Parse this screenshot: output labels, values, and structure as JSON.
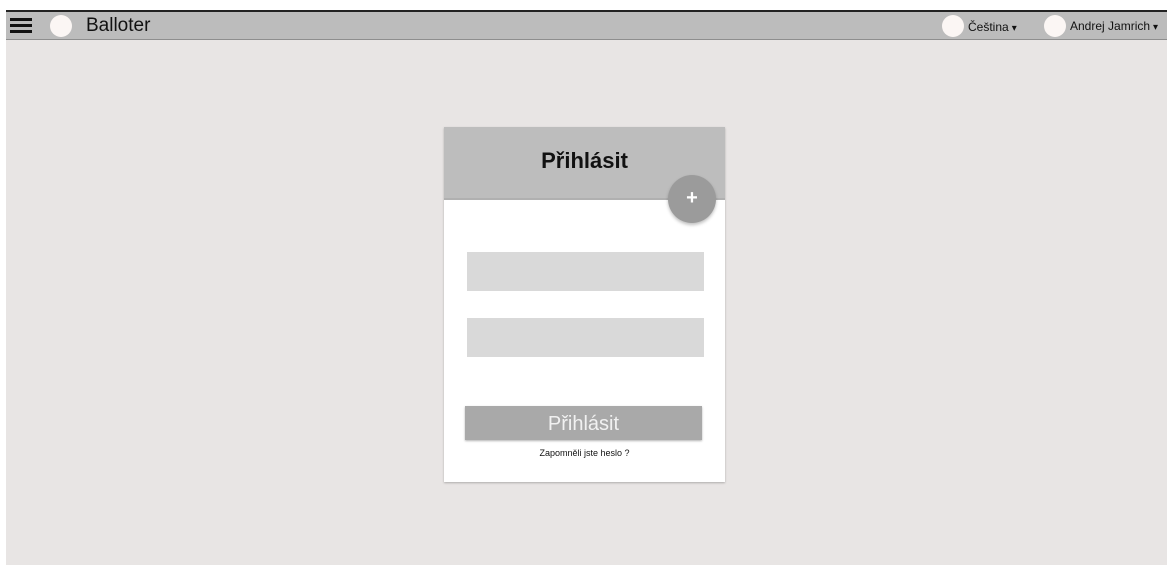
{
  "topbar": {
    "menu_icon": "hamburger-menu-icon",
    "app_title": "Balloter",
    "language_label": "Čeština",
    "user_label": "Andrej Jamrich",
    "caret_glyph": "▾"
  },
  "login_card": {
    "title": "Přihlásit",
    "add_button_glyph": "+",
    "username_value": "",
    "password_value": "",
    "submit_label": "Přihlásit",
    "forgot_password_label": "Zapomněli jste heslo ?"
  },
  "colors": {
    "page_background": "#e8e5e4",
    "topbar_background": "#bcbcbc",
    "card_header_background": "#bdbdbd",
    "input_background": "#d9d9d9",
    "button_background": "#a9a9a9",
    "fab_background": "#9b9b9b"
  }
}
